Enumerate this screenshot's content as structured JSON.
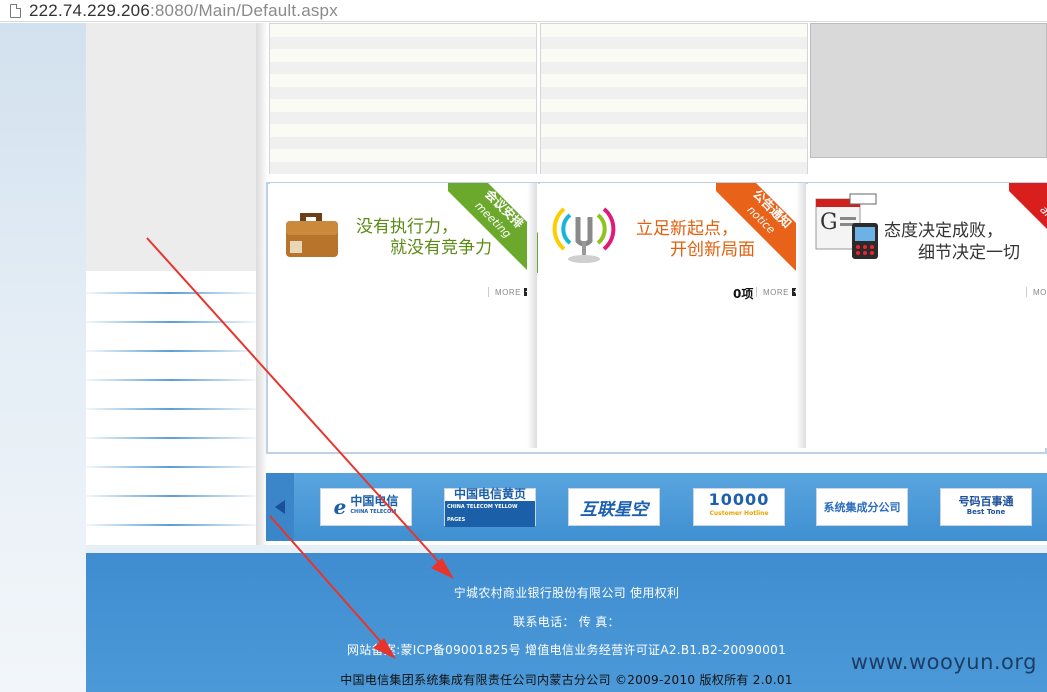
{
  "browser": {
    "url_host": "222.74.229.206",
    "url_rest": ":8080/Main/Default.aspx"
  },
  "panels": [
    {
      "tag_cn": "会议安排",
      "tag_en": "meeting",
      "tag_color": "#6aa92c",
      "slogan_line1": "没有执行力，",
      "slogan_line2": "就没有竞争力",
      "more_label": "MORE",
      "icon": "briefcase-icon"
    },
    {
      "tag_cn": "公告通知",
      "tag_en": "notice",
      "tag_color": "#e8621a",
      "slogan_line1": "立足新起点，",
      "slogan_line2": "开创新局面",
      "count": "0项",
      "more_label": "MORE",
      "icon": "antenna-icon"
    },
    {
      "tag_cn": "I",
      "tag_en": "annou",
      "tag_color": "#d91e1e",
      "slogan_line1": "态度决定成败，",
      "slogan_line2": "细节决定一切",
      "more_label": "MORE",
      "icon": "newspaper-icon"
    }
  ],
  "partners": [
    {
      "name": "中国电信",
      "sub": "CHINA TELECOM",
      "color": "#1b5fa8"
    },
    {
      "name": "中国电信黄页",
      "sub": "CHINA TELECOM YELLOW PAGES",
      "color": "#1b5fa8"
    },
    {
      "name": "互联星空",
      "sub": "",
      "color": "#1d5fb0"
    },
    {
      "name": "10000",
      "sub": "Customer Hotline",
      "color": "#1d5fb0"
    },
    {
      "name": "系统集成分公司",
      "sub": "",
      "color": "#2a6cc0"
    },
    {
      "name": "号码百事通",
      "sub": "Best Tone",
      "color": "#1d4f9a"
    }
  ],
  "footer": {
    "company": "宁城农村商业银行股份有限公司   使用权利",
    "contact": "联系电话：   传 真：",
    "icp": "网站备案:蒙ICP备09001825号    增值电信业务经营许可证A2.B1.B2-20090001",
    "copyright": "中国电信集团系统集成有限责任公司内蒙古分公司 ©2009-2010 版权所有 2.0.01"
  },
  "watermark": "www.wooyun.org",
  "colors": {
    "footer_bg": "#3f8dd0",
    "annotation": "#e8342c"
  }
}
